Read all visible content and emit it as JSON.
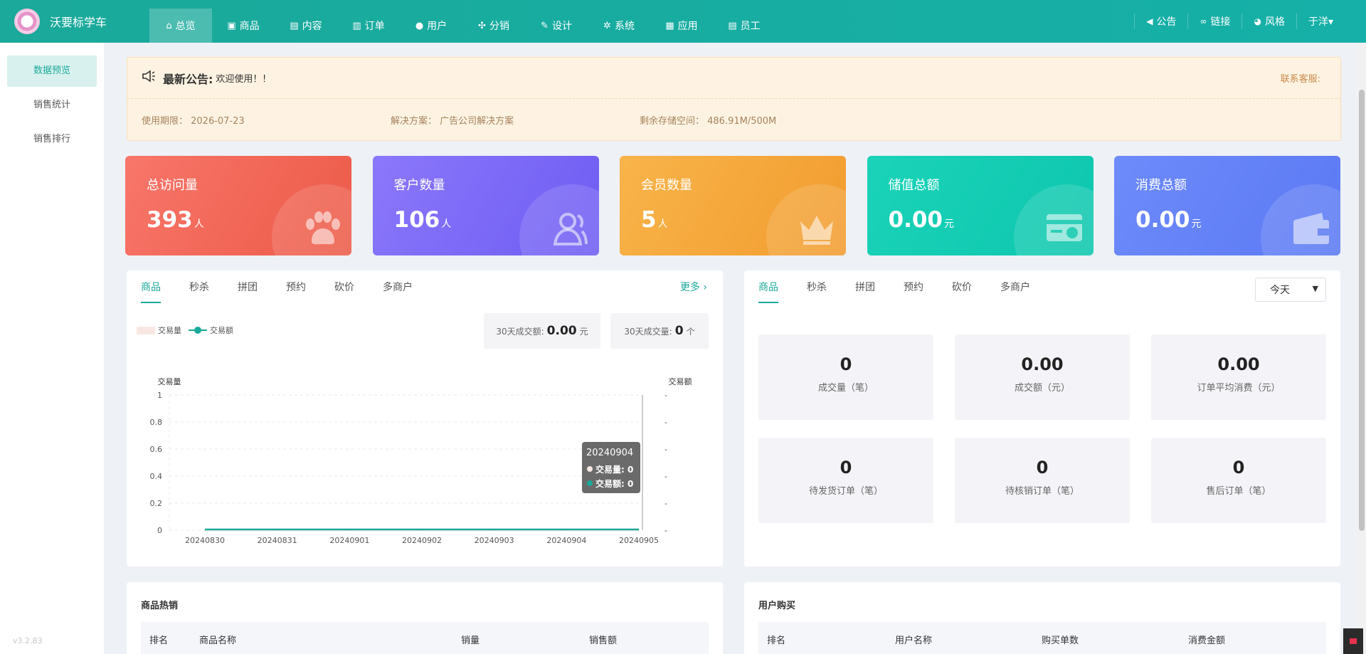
{
  "brand": {
    "name": "沃要标学车"
  },
  "nav": [
    {
      "label": "总览",
      "icon": "home-icon",
      "glyph": "⌂",
      "active": true
    },
    {
      "label": "商品",
      "icon": "bag-icon",
      "glyph": "▣"
    },
    {
      "label": "内容",
      "icon": "document-icon",
      "glyph": "▤"
    },
    {
      "label": "订单",
      "icon": "clipboard-icon",
      "glyph": "▥"
    },
    {
      "label": "用户",
      "icon": "user-icon",
      "glyph": "●"
    },
    {
      "label": "分销",
      "icon": "share-icon",
      "glyph": "✣"
    },
    {
      "label": "设计",
      "icon": "brush-icon",
      "glyph": "✎"
    },
    {
      "label": "系统",
      "icon": "gear-icon",
      "glyph": "✲"
    },
    {
      "label": "应用",
      "icon": "grid-icon",
      "glyph": "▦"
    },
    {
      "label": "员工",
      "icon": "lock-icon",
      "glyph": "▤"
    }
  ],
  "right_links": [
    {
      "label": "公告",
      "icon": "megaphone-icon",
      "glyph": "◀"
    },
    {
      "label": "链接",
      "icon": "link-icon",
      "glyph": "∞"
    },
    {
      "label": "风格",
      "icon": "palette-icon",
      "glyph": "◕"
    },
    {
      "label": "于洋▾",
      "icon": "",
      "glyph": ""
    }
  ],
  "side_menu": [
    {
      "label": "数据预览",
      "active": true
    },
    {
      "label": "销售统计"
    },
    {
      "label": "销售排行"
    }
  ],
  "version": "v3.2.83",
  "notice": {
    "title": "最新公告:",
    "text": "欢迎使用！！",
    "contact": "联系客服:",
    "info": [
      "使用期限：  2026-07-23",
      "解决方案：  广告公司解决方案",
      "剩余存储空间：  486.91M/500M"
    ]
  },
  "stats": [
    {
      "title": "总访问量",
      "value": "393",
      "unit": "人",
      "icon": "paw-icon",
      "from": "#f8766a",
      "to": "#ec5a47"
    },
    {
      "title": "客户数量",
      "value": "106",
      "unit": "人",
      "icon": "users-icon",
      "from": "#8b78fb",
      "to": "#6e5cf3"
    },
    {
      "title": "会员数量",
      "value": "5",
      "unit": "人",
      "icon": "crown-icon",
      "from": "#f8b44a",
      "to": "#f29c2e"
    },
    {
      "title": "储值总额",
      "value": "0.00",
      "unit": "元",
      "icon": "card-icon",
      "from": "#1ad3b8",
      "to": "#0dc6ae"
    },
    {
      "title": "消费总额",
      "value": "0.00",
      "unit": "元",
      "icon": "wallet-icon",
      "from": "#6e8bfb",
      "to": "#5b79f3"
    }
  ],
  "chart_panel": {
    "tabs": [
      "商品",
      "秒杀",
      "拼团",
      "预约",
      "砍价",
      "多商户"
    ],
    "more": "更多 ›",
    "sum_amount_label": "30天成交额:",
    "sum_amount_value": "0.00",
    "sum_amount_unit": "元",
    "sum_count_label": "30天成交量:",
    "sum_count_value": "0",
    "sum_count_unit": "个"
  },
  "chart_data": {
    "type": "line",
    "x": [
      "20240830",
      "20240831",
      "20240901",
      "20240902",
      "20240903",
      "20240904",
      "20240905"
    ],
    "series": [
      {
        "name": "交易量",
        "values": [
          0,
          0,
          0,
          0,
          0,
          0,
          0
        ],
        "color": "#f7e6e2"
      },
      {
        "name": "交易额",
        "values": [
          0,
          0,
          0,
          0,
          0,
          0,
          0
        ],
        "color": "#1aa99a"
      }
    ],
    "ylabel_left": "交易量",
    "ylabel_right": "交易额",
    "y_ticks": [
      "0",
      "0.2",
      "0.4",
      "0.6",
      "0.8",
      "1"
    ],
    "ylim": [
      0,
      1
    ],
    "right_ticks": [
      "-",
      "-",
      "-",
      "-",
      "-",
      "-"
    ],
    "grid": true,
    "tooltip": {
      "date": "20240904",
      "rows": [
        "交易量: 0",
        "交易额: 0"
      ]
    }
  },
  "today_panel": {
    "tabs": [
      "商品",
      "秒杀",
      "拼团",
      "预约",
      "砍价",
      "多商户"
    ],
    "select": "今天",
    "tiles": [
      {
        "value": "0",
        "label": "成交量（笔）"
      },
      {
        "value": "0.00",
        "label": "成交额（元）"
      },
      {
        "value": "0.00",
        "label": "订单平均消费（元）"
      },
      {
        "value": "0",
        "label": "待发货订单（笔）"
      },
      {
        "value": "0",
        "label": "待核销订单（笔）"
      },
      {
        "value": "0",
        "label": "售后订单（笔）"
      }
    ]
  },
  "hot_goods": {
    "title": "商品热销",
    "columns": [
      "排名",
      "商品名称",
      "销量",
      "销售额"
    ]
  },
  "user_buy": {
    "title": "用户购买",
    "columns": [
      "排名",
      "用户名称",
      "购买单数",
      "消费金额"
    ]
  },
  "colors": {
    "accent": "#1aa99a"
  }
}
